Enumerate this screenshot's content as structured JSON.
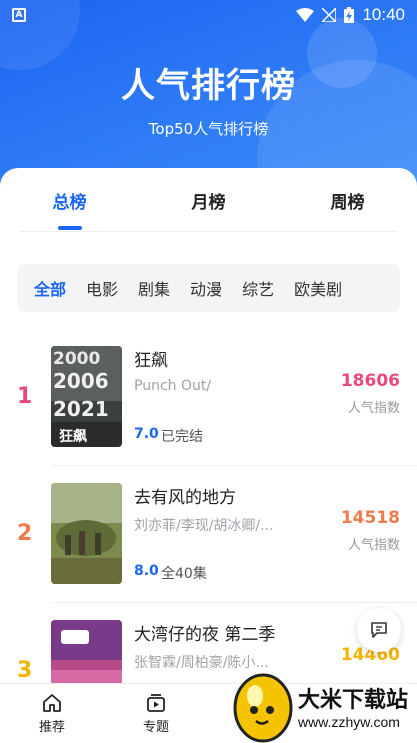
{
  "status_bar": {
    "time": "10:40"
  },
  "header": {
    "title": "人气排行榜",
    "subtitle": "Top50人气排行榜"
  },
  "tabs": [
    "总榜",
    "月榜",
    "周榜"
  ],
  "filters": [
    "全部",
    "电影",
    "剧集",
    "动漫",
    "综艺",
    "欧美剧"
  ],
  "items": [
    {
      "rank": "1",
      "name": "狂飙",
      "sub": "Punch Out/",
      "score": "7.0",
      "status": "已完结",
      "popularity": "18606",
      "popularity_label": "人气指数",
      "poster_text": "狂飙",
      "rank_color": "#e64a7b",
      "pop_color": "#e64a7b"
    },
    {
      "rank": "2",
      "name": "去有风的地方",
      "sub": "刘亦菲/李现/胡冰卿/...",
      "score": "8.0",
      "status": "全40集",
      "popularity": "14518",
      "popularity_label": "人气指数",
      "rank_color": "#f07b4a",
      "pop_color": "#f07b4a"
    },
    {
      "rank": "3",
      "name": "大湾仔的夜 第二季",
      "sub": "张智霖/周柏豪/陈小...",
      "popularity": "14460",
      "rank_color": "#f5b400",
      "pop_color": "#f5b400"
    }
  ],
  "bottom_nav": [
    {
      "label": "推荐",
      "icon": "home-icon"
    },
    {
      "label": "专题",
      "icon": "play-card-icon"
    }
  ],
  "watermark": {
    "text": "大米下载站",
    "url": "www.zzhyw.com"
  }
}
